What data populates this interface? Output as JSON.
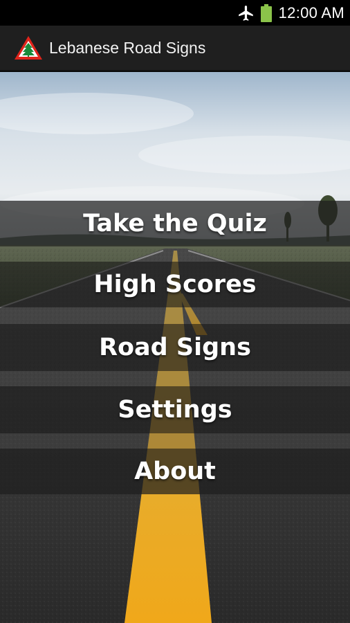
{
  "status_bar": {
    "time": "12:00 AM",
    "icons": [
      "airplane-mode-icon",
      "battery-icon"
    ],
    "battery_color": "#8bc34a"
  },
  "action_bar": {
    "title": "Lebanese Road Signs",
    "logo_icon": "lebanon-cedar-warning-sign-icon",
    "logo_colors": {
      "border": "#e0241b",
      "fill": "#ffffff",
      "cedar": "#1b8a3a"
    }
  },
  "menu": {
    "items": [
      {
        "label": "Take the Quiz"
      },
      {
        "label": "High Scores"
      },
      {
        "label": "Road Signs"
      },
      {
        "label": "Settings"
      },
      {
        "label": "About"
      }
    ]
  },
  "background": {
    "description_icon": "road-background-image",
    "road_line_color": "#e8b21a"
  }
}
